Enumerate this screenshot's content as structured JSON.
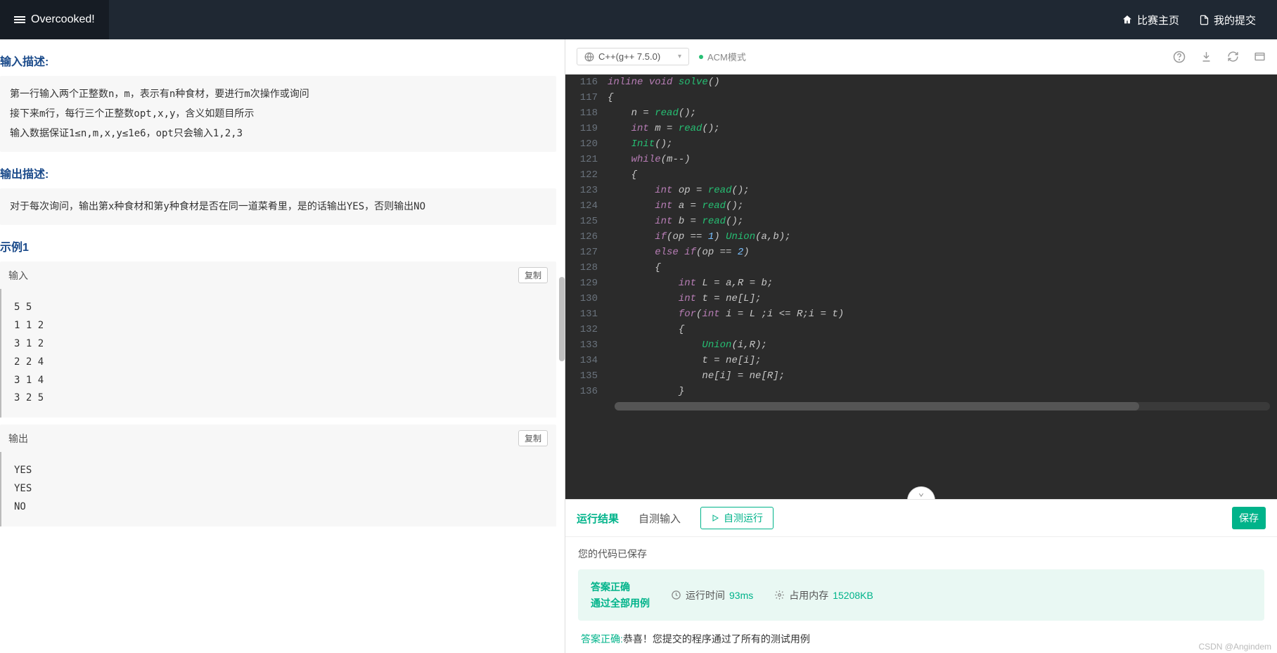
{
  "header": {
    "title": "Overcooked!",
    "links": {
      "contest_home": "比赛主页",
      "my_submissions": "我的提交"
    }
  },
  "problem": {
    "input_desc_title": "输入描述:",
    "input_desc": "第一行输入两个正整数n，m，表示有n种食材，要进行m次操作或询问\n接下来m行，每行三个正整数opt,x,y，含义如题目所示\n输入数据保证1≤n,m,x,y≤1e6，opt只会输入1,2,3",
    "output_desc_title": "输出描述:",
    "output_desc": "对于每次询问，输出第x种食材和第y种食材是否在同一道菜肴里，是的话输出YES，否则输出NO",
    "example_title": "示例1",
    "input_label": "输入",
    "output_label": "输出",
    "copy_label": "复制",
    "example_input": "5 5\n1 1 2\n3 1 2\n2 2 4\n3 1 4\n3 2 5",
    "example_output": "YES\nYES\nNO"
  },
  "editor": {
    "language": "C++(g++ 7.5.0)",
    "mode": "ACM模式",
    "code_lines": [
      {
        "n": 116,
        "seg": [
          [
            "kw",
            "inline "
          ],
          [
            "kw",
            "void "
          ],
          [
            "fn",
            "solve"
          ],
          [
            "op",
            "()"
          ]
        ]
      },
      {
        "n": 117,
        "seg": [
          [
            "op",
            "{"
          ]
        ]
      },
      {
        "n": 118,
        "seg": [
          [
            "sp",
            "    "
          ],
          [
            "id",
            "n "
          ],
          [
            "op",
            "= "
          ],
          [
            "fn",
            "read"
          ],
          [
            "op",
            "();"
          ]
        ]
      },
      {
        "n": 119,
        "seg": [
          [
            "sp",
            "    "
          ],
          [
            "kw",
            "int "
          ],
          [
            "id",
            "m "
          ],
          [
            "op",
            "= "
          ],
          [
            "fn",
            "read"
          ],
          [
            "op",
            "();"
          ]
        ]
      },
      {
        "n": 120,
        "seg": [
          [
            "sp",
            "    "
          ],
          [
            "fn",
            "Init"
          ],
          [
            "op",
            "();"
          ]
        ]
      },
      {
        "n": 121,
        "seg": [
          [
            "sp",
            "    "
          ],
          [
            "kw",
            "while"
          ],
          [
            "op",
            "("
          ],
          [
            "id",
            "m"
          ],
          [
            "op",
            "--)"
          ]
        ]
      },
      {
        "n": 122,
        "seg": [
          [
            "sp",
            "    "
          ],
          [
            "op",
            "{"
          ]
        ]
      },
      {
        "n": 123,
        "seg": [
          [
            "sp",
            "        "
          ],
          [
            "kw",
            "int "
          ],
          [
            "id",
            "op "
          ],
          [
            "op",
            "= "
          ],
          [
            "fn",
            "read"
          ],
          [
            "op",
            "();"
          ]
        ]
      },
      {
        "n": 124,
        "seg": [
          [
            "sp",
            "        "
          ],
          [
            "kw",
            "int "
          ],
          [
            "id",
            "a "
          ],
          [
            "op",
            "= "
          ],
          [
            "fn",
            "read"
          ],
          [
            "op",
            "();"
          ]
        ]
      },
      {
        "n": 125,
        "seg": [
          [
            "sp",
            "        "
          ],
          [
            "kw",
            "int "
          ],
          [
            "id",
            "b "
          ],
          [
            "op",
            "= "
          ],
          [
            "fn",
            "read"
          ],
          [
            "op",
            "();"
          ]
        ]
      },
      {
        "n": 126,
        "seg": [
          [
            "sp",
            "        "
          ],
          [
            "kw",
            "if"
          ],
          [
            "op",
            "("
          ],
          [
            "id",
            "op "
          ],
          [
            "op",
            "== "
          ],
          [
            "num",
            "1"
          ],
          [
            "op",
            ") "
          ],
          [
            "fn",
            "Union"
          ],
          [
            "op",
            "("
          ],
          [
            "id",
            "a"
          ],
          [
            "op",
            ","
          ],
          [
            "id",
            "b"
          ],
          [
            "op",
            ");"
          ]
        ]
      },
      {
        "n": 127,
        "seg": [
          [
            "sp",
            "        "
          ],
          [
            "kw",
            "else if"
          ],
          [
            "op",
            "("
          ],
          [
            "id",
            "op "
          ],
          [
            "op",
            "== "
          ],
          [
            "num",
            "2"
          ],
          [
            "op",
            ")"
          ]
        ]
      },
      {
        "n": 128,
        "seg": [
          [
            "sp",
            "        "
          ],
          [
            "op",
            "{"
          ]
        ]
      },
      {
        "n": 129,
        "seg": [
          [
            "sp",
            "            "
          ],
          [
            "kw",
            "int "
          ],
          [
            "id",
            "L "
          ],
          [
            "op",
            "= "
          ],
          [
            "id",
            "a"
          ],
          [
            "op",
            ","
          ],
          [
            "id",
            "R "
          ],
          [
            "op",
            "= "
          ],
          [
            "id",
            "b"
          ],
          [
            "op",
            ";"
          ]
        ]
      },
      {
        "n": 130,
        "seg": [
          [
            "sp",
            "            "
          ],
          [
            "kw",
            "int "
          ],
          [
            "id",
            "t "
          ],
          [
            "op",
            "= "
          ],
          [
            "id",
            "ne"
          ],
          [
            "op",
            "["
          ],
          [
            "id",
            "L"
          ],
          [
            "op",
            "];"
          ]
        ]
      },
      {
        "n": 131,
        "seg": [
          [
            "sp",
            "            "
          ],
          [
            "kw",
            "for"
          ],
          [
            "op",
            "("
          ],
          [
            "kw",
            "int "
          ],
          [
            "id",
            "i "
          ],
          [
            "op",
            "= "
          ],
          [
            "id",
            "L "
          ],
          [
            "op",
            ";"
          ],
          [
            "id",
            "i "
          ],
          [
            "op",
            "<= "
          ],
          [
            "id",
            "R"
          ],
          [
            "op",
            ";"
          ],
          [
            "id",
            "i "
          ],
          [
            "op",
            "= "
          ],
          [
            "id",
            "t"
          ],
          [
            "op",
            ")"
          ]
        ]
      },
      {
        "n": 132,
        "seg": [
          [
            "sp",
            "            "
          ],
          [
            "op",
            "{"
          ]
        ]
      },
      {
        "n": 133,
        "seg": [
          [
            "sp",
            "                "
          ],
          [
            "fn",
            "Union"
          ],
          [
            "op",
            "("
          ],
          [
            "id",
            "i"
          ],
          [
            "op",
            ","
          ],
          [
            "id",
            "R"
          ],
          [
            "op",
            ");"
          ]
        ]
      },
      {
        "n": 134,
        "seg": [
          [
            "sp",
            "                "
          ],
          [
            "id",
            "t "
          ],
          [
            "op",
            "= "
          ],
          [
            "id",
            "ne"
          ],
          [
            "op",
            "["
          ],
          [
            "id",
            "i"
          ],
          [
            "op",
            "];"
          ]
        ]
      },
      {
        "n": 135,
        "seg": [
          [
            "sp",
            "                "
          ],
          [
            "id",
            "ne"
          ],
          [
            "op",
            "["
          ],
          [
            "id",
            "i"
          ],
          [
            "op",
            "] = "
          ],
          [
            "id",
            "ne"
          ],
          [
            "op",
            "["
          ],
          [
            "id",
            "R"
          ],
          [
            "op",
            "];"
          ]
        ]
      },
      {
        "n": 136,
        "seg": [
          [
            "sp",
            "            "
          ],
          [
            "op",
            "}"
          ]
        ]
      }
    ]
  },
  "results": {
    "tab_run": "运行结果",
    "tab_self": "自测输入",
    "btn_run": "自测运行",
    "btn_save": "保存",
    "saved_msg": "您的代码已保存",
    "verdict_line1": "答案正确",
    "verdict_line2": "通过全部用例",
    "time_label": "运行时间",
    "time_value": "93ms",
    "mem_label": "占用内存",
    "mem_value": "15208KB",
    "congrats_green": "答案正确:",
    "congrats_rest": "恭喜！您提交的程序通过了所有的测试用例"
  },
  "watermark": "CSDN @Angindem"
}
